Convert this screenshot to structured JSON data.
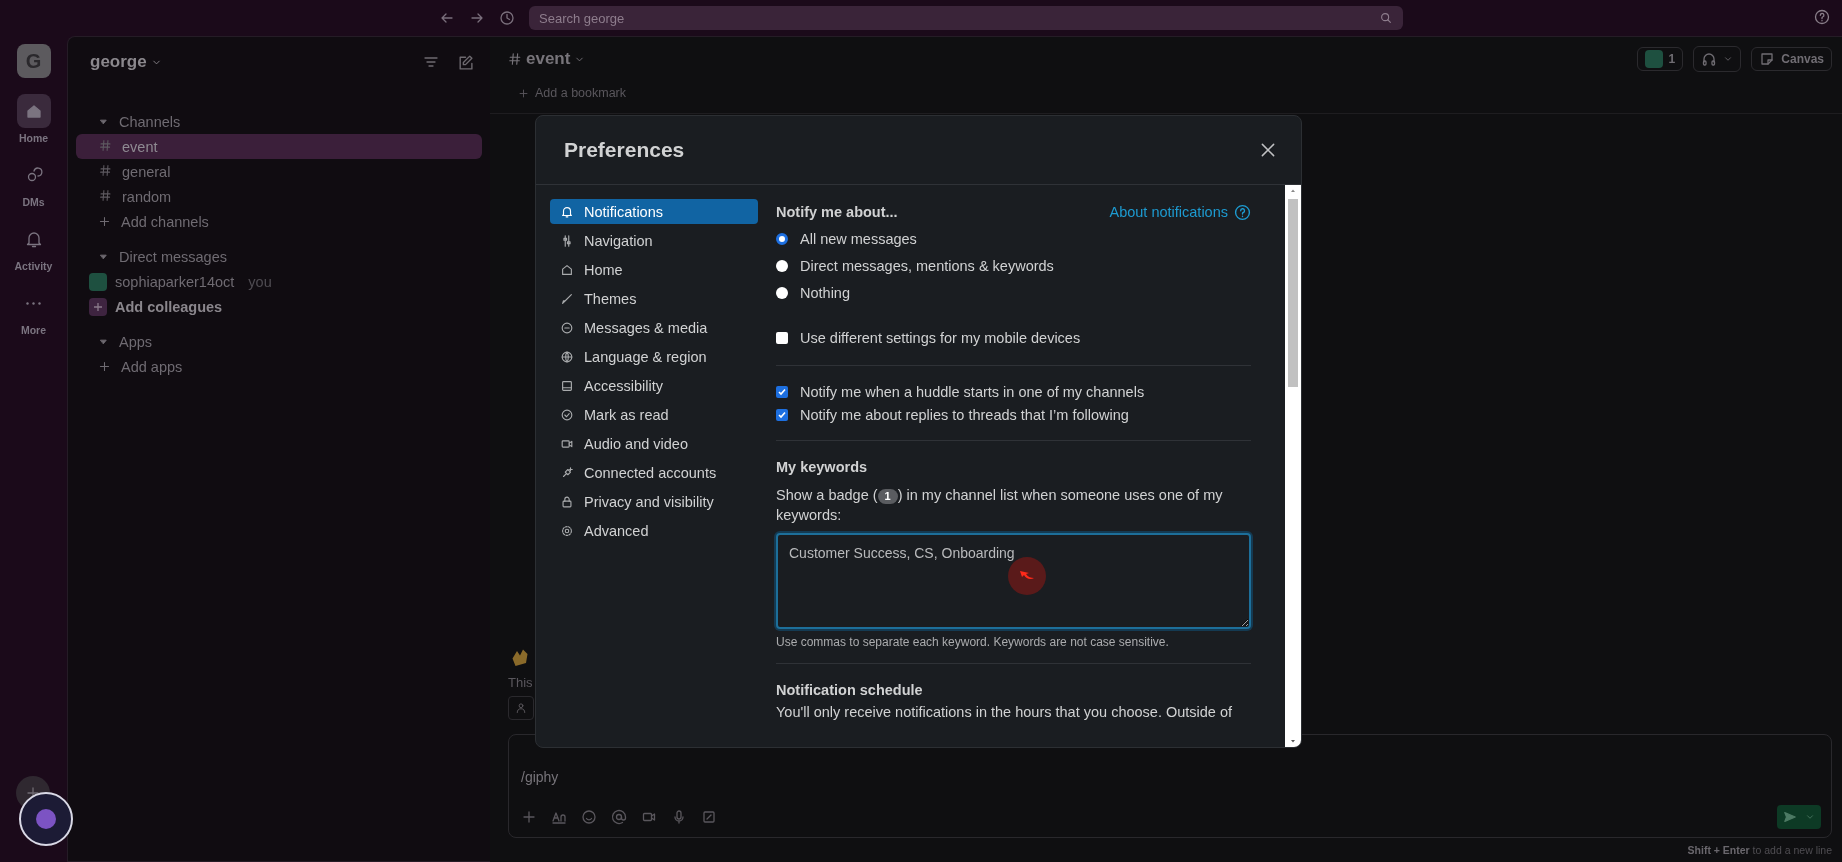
{
  "topbar": {
    "search_placeholder": "Search george"
  },
  "rail": {
    "workspace_initial": "G",
    "items": [
      {
        "label": "Home",
        "selected": true
      },
      {
        "label": "DMs",
        "selected": false
      },
      {
        "label": "Activity",
        "selected": false
      },
      {
        "label": "More",
        "selected": false
      }
    ]
  },
  "sidebar": {
    "workspace": "george",
    "sections": [
      {
        "title": "Channels",
        "items": [
          {
            "kind": "channel",
            "label": "event",
            "selected": true
          },
          {
            "kind": "channel",
            "label": "general",
            "selected": false
          },
          {
            "kind": "channel",
            "label": "random",
            "selected": false
          },
          {
            "kind": "add",
            "label": "Add channels",
            "selected": false
          }
        ]
      },
      {
        "title": "Direct messages",
        "items": [
          {
            "kind": "user",
            "label": "sophiaparker14oct",
            "note": "you",
            "selected": false
          },
          {
            "kind": "invite",
            "label": "Add colleagues",
            "selected": false
          }
        ]
      },
      {
        "title": "Apps",
        "items": [
          {
            "kind": "add",
            "label": "Add apps",
            "selected": false
          }
        ]
      }
    ]
  },
  "channel_header": {
    "name": "event",
    "member_count": "1",
    "canvas_label": "Canvas",
    "bookmark": "Add a bookmark"
  },
  "messages": {
    "intro": "This"
  },
  "composer": {
    "value": "/giphy",
    "hint": "**Shift + Enter** to add a new line"
  },
  "preferences": {
    "title": "Preferences",
    "nav": [
      {
        "label": "Notifications",
        "selected": true
      },
      {
        "label": "Navigation",
        "selected": false
      },
      {
        "label": "Home",
        "selected": false
      },
      {
        "label": "Themes",
        "selected": false
      },
      {
        "label": "Messages & media",
        "selected": false
      },
      {
        "label": "Language & region",
        "selected": false
      },
      {
        "label": "Accessibility",
        "selected": false
      },
      {
        "label": "Mark as read",
        "selected": false
      },
      {
        "label": "Audio and video",
        "selected": false
      },
      {
        "label": "Connected accounts",
        "selected": false
      },
      {
        "label": "Privacy and visibility",
        "selected": false
      },
      {
        "label": "Advanced",
        "selected": false
      }
    ],
    "notify_title": "Notify me about...",
    "about_link": "About notifications",
    "radios": [
      {
        "label": "All new messages",
        "selected": true
      },
      {
        "label": "Direct messages, mentions & keywords",
        "selected": false
      },
      {
        "label": "Nothing",
        "selected": false
      }
    ],
    "mobile": {
      "label": "Use different settings for my mobile devices",
      "checked": false
    },
    "checks": [
      {
        "label": "Notify me when a huddle starts in one of my channels",
        "checked": true
      },
      {
        "label": "Notify me about replies to threads that I’m following",
        "checked": true
      }
    ],
    "keywords_title": "My keywords",
    "keywords_desc_before": "Show a badge (",
    "keywords_badge": "1",
    "keywords_desc_after": ") in my channel list when someone uses one of my keywords:",
    "keywords_value": "Customer Success, CS, Onboarding",
    "keywords_hint": "Use commas to separate each keyword. Keywords are not case sensitive.",
    "schedule_title": "Notification schedule",
    "schedule_text": "You'll only receive notifications in the hours that you choose. Outside of"
  }
}
